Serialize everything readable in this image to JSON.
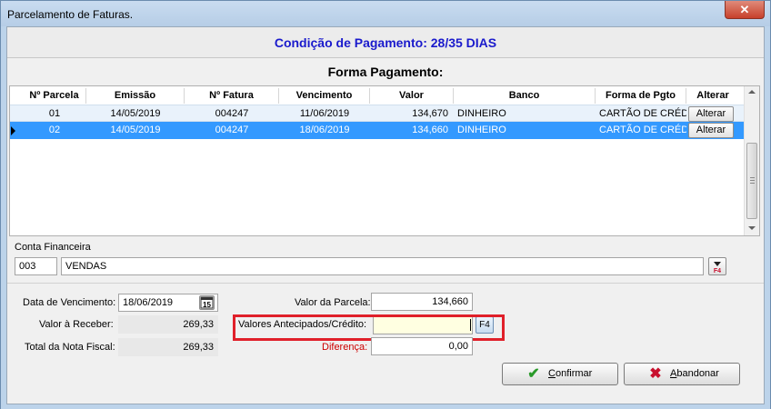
{
  "window": {
    "title": "Parcelamento de Faturas.",
    "close_glyph": "✕"
  },
  "condicao": "Condição de Pagamento: 28/35 DIAS",
  "forma_pagamento_title": "Forma Pagamento:",
  "grid": {
    "columns": [
      "Nº Parcela",
      "Emissão",
      "Nº Fatura",
      "Vencimento",
      "Valor",
      "Banco",
      "Forma de Pgto",
      "Alterar"
    ],
    "rows": [
      {
        "parcela": "01",
        "emissao": "14/05/2019",
        "fatura": "004247",
        "vencimento": "11/06/2019",
        "valor": "134,670",
        "banco": "DINHEIRO",
        "forma": "CARTÃO DE CRÉDITO",
        "alterar": "Alterar"
      },
      {
        "parcela": "02",
        "emissao": "14/05/2019",
        "fatura": "004247",
        "vencimento": "18/06/2019",
        "valor": "134,660",
        "banco": "DINHEIRO",
        "forma": "CARTÃO DE CRÉDITO",
        "alterar": "Alterar"
      }
    ]
  },
  "conta_financeira": {
    "label": "Conta Financeira",
    "code": "003",
    "name": "VENDAS",
    "lookup_key": "F4"
  },
  "summary": {
    "data_vencimento_label": "Data de Vencimento:",
    "data_vencimento": "18/06/2019",
    "calendar_icon_text": "15",
    "valor_receber_label": "Valor à Receber:",
    "valor_receber": "269,33",
    "total_nf_label": "Total da Nota Fiscal:",
    "total_nf": "269,33",
    "valor_parcela_label": "Valor da Parcela:",
    "valor_parcela": "134,660",
    "antecipados_label": "Valores Antecipados/Crédito:",
    "antecipados_value": "",
    "f4_label": "F4",
    "diferenca_label": "Diferença:",
    "diferenca": "0,00"
  },
  "buttons": {
    "confirmar_first": "C",
    "confirmar_rest": "onfirmar",
    "abandonar_first": "A",
    "abandonar_rest": "bandonar"
  },
  "colors": {
    "selected_row": "#3399ff",
    "title_blue": "#1a1acc",
    "highlight_red": "#e0202a",
    "confirm_green": "#2a9a2a",
    "abandon_red": "#c8102e"
  },
  "icons": {
    "close": "close-icon",
    "calendar": "calendar-icon",
    "lookup": "lookup-icon",
    "confirm": "checkmark-icon",
    "abandon": "x-icon"
  }
}
